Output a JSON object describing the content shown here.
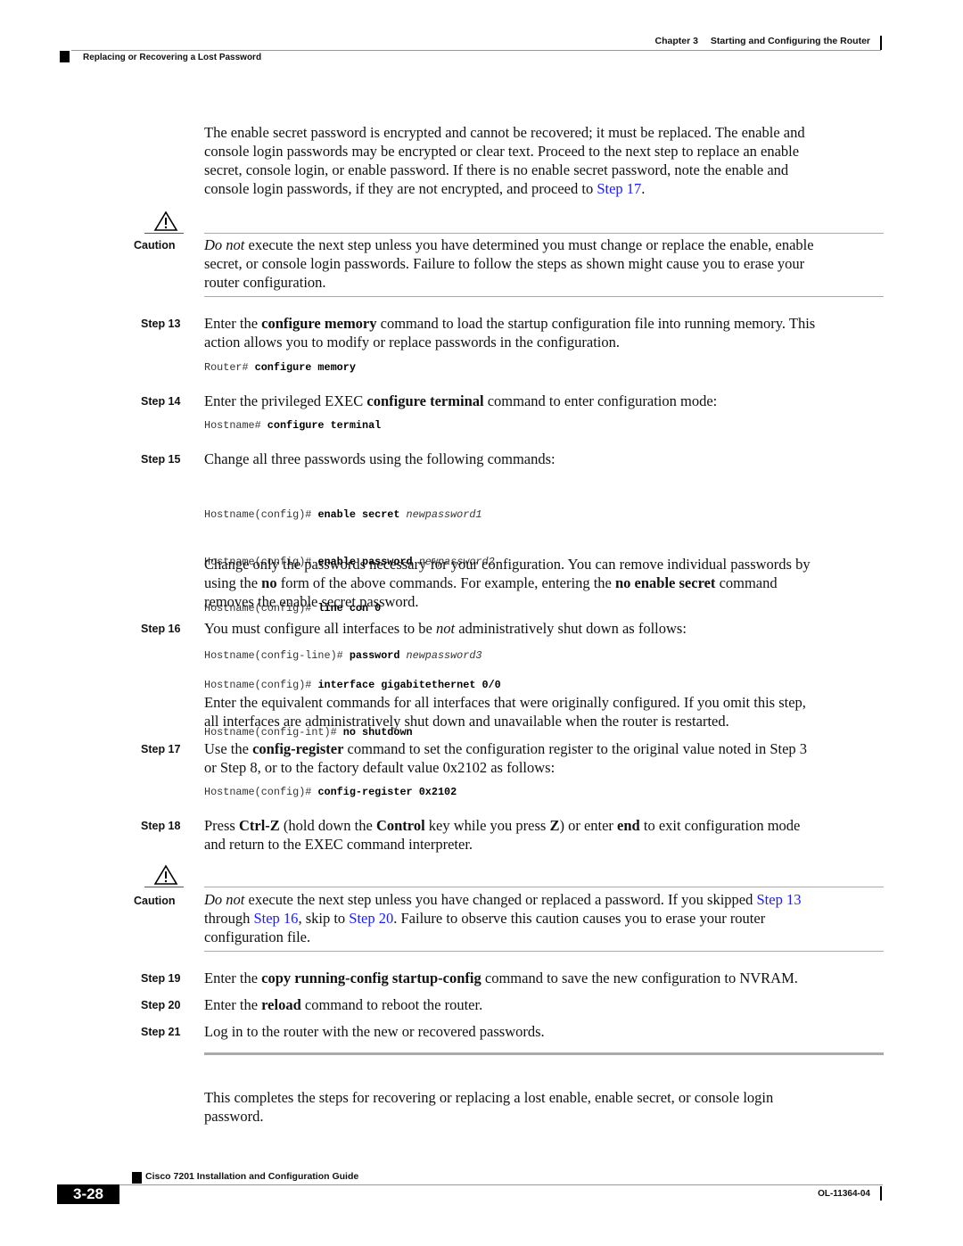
{
  "header": {
    "chapter_label": "Chapter 3",
    "chapter_title": "Starting and Configuring the Router",
    "section_title": "Replacing or Recovering a Lost Password"
  },
  "intro": {
    "line1": "The enable secret password is encrypted and cannot be recovered; it must be replaced. The enable and",
    "line2": "console login passwords may be encrypted or clear text. Proceed to the next step to replace an enable",
    "line3": "secret, console login, or enable password. If there is no enable secret password, note the enable and",
    "line4_pre": "console login passwords, if they are not encrypted, and proceed to ",
    "line4_link": "Step 17",
    "line4_post": "."
  },
  "caution1": {
    "label": "Caution",
    "em": "Do not",
    "line1": " execute the next step unless you have determined you must change or replace the enable, enable",
    "line2": "secret, or console login passwords. Failure to follow the steps as shown might cause you to erase your",
    "line3": "router configuration."
  },
  "steps": {
    "s13": {
      "label": "Step 13",
      "t1": "Enter the ",
      "b1": "configure memory",
      "t2": " command to load the startup configuration file into running memory. This",
      "line2": "action allows you to modify or replace passwords in the configuration.",
      "cli_prompt": "Router# ",
      "cli_cmd": "configure memory"
    },
    "s14": {
      "label": "Step 14",
      "t1": "Enter the privileged EXEC ",
      "b1": "configure terminal",
      "t2": " command to enter configuration mode:",
      "cli_prompt": "Hostname# ",
      "cli_cmd": "configure terminal"
    },
    "s15": {
      "label": "Step 15",
      "text": "Change all three passwords using the following commands:",
      "cli": [
        {
          "prompt": "Hostname(config)# ",
          "cmd": "enable secret",
          "arg": " newpassword1"
        },
        {
          "prompt": "Hostname(config)# ",
          "cmd": "enable password",
          "arg": " newpassword2"
        },
        {
          "prompt": "Hostname(config)# ",
          "cmd": "line con 0",
          "arg": ""
        },
        {
          "prompt": "Hostname(config-line)# ",
          "cmd": "password",
          "arg": " newpassword3"
        }
      ],
      "note_l1": "Change only the passwords necessary for your configuration. You can remove individual passwords by",
      "note_l2_a": "using the ",
      "note_l2_b": "no",
      "note_l2_c": " form of the above commands. For example, entering the ",
      "note_l2_d": "no enable secret",
      "note_l2_e": " command",
      "note_l3": "removes the enable secret password."
    },
    "s16": {
      "label": "Step 16",
      "t1": "You must configure all interfaces to be ",
      "em": "not",
      "t2": " administratively shut down as follows:",
      "cli": [
        {
          "prompt": "Hostname(config)# ",
          "cmd": "interface gigabitethernet 0/0"
        },
        {
          "prompt": "Hostname(config-int)# ",
          "cmd": "no shutdown"
        }
      ],
      "note_l1": "Enter the equivalent commands for all interfaces that were originally configured. If you omit this step,",
      "note_l2": "all interfaces are administratively shut down and unavailable when the router is restarted."
    },
    "s17": {
      "label": "Step 17",
      "t1": "Use the ",
      "b1": "config-register",
      "t2": " command to set the configuration register to the original value noted in Step 3",
      "line2": "or Step 8, or to the factory default value 0x2102 as follows:",
      "cli_prompt": "Hostname(config)# ",
      "cli_cmd": "config-register 0x2102"
    },
    "s18": {
      "label": "Step 18",
      "t1": "Press ",
      "b1": "Ctrl-Z",
      "t2": " (hold down the ",
      "b2": "Control",
      "t3": " key while you press ",
      "b3": "Z",
      "t4": ") or enter ",
      "b4": "end",
      "t5": " to exit configuration mode",
      "line2": "and return to the EXEC command interpreter."
    },
    "s19": {
      "label": "Step 19",
      "t1": "Enter the ",
      "b1": "copy running-config startup-config",
      "t2": " command to save the new configuration to NVRAM."
    },
    "s20": {
      "label": "Step 20",
      "t1": "Enter the ",
      "b1": "reload",
      "t2": " command to reboot the router."
    },
    "s21": {
      "label": "Step 21",
      "text": "Log in to the router with the new or recovered passwords."
    }
  },
  "caution2": {
    "label": "Caution",
    "em": "Do not",
    "l1_a": " execute the next step unless you have changed or replaced a password. If you skipped ",
    "l1_link": "Step 13",
    "l2_link1": "Step 16",
    "l2_a": "through ",
    "l2_b": ", skip to ",
    "l2_link2": "Step 20",
    "l2_c": ". Failure to observe this caution causes you to erase your router",
    "line3": "configuration file."
  },
  "closing": {
    "line1": "This completes the steps for recovering or replacing a lost enable, enable secret, or console login",
    "line2": "password."
  },
  "footer": {
    "guide_title": "Cisco 7201 Installation and Configuration Guide",
    "page_number": "3-28",
    "doc_number": "OL-11364-04"
  }
}
